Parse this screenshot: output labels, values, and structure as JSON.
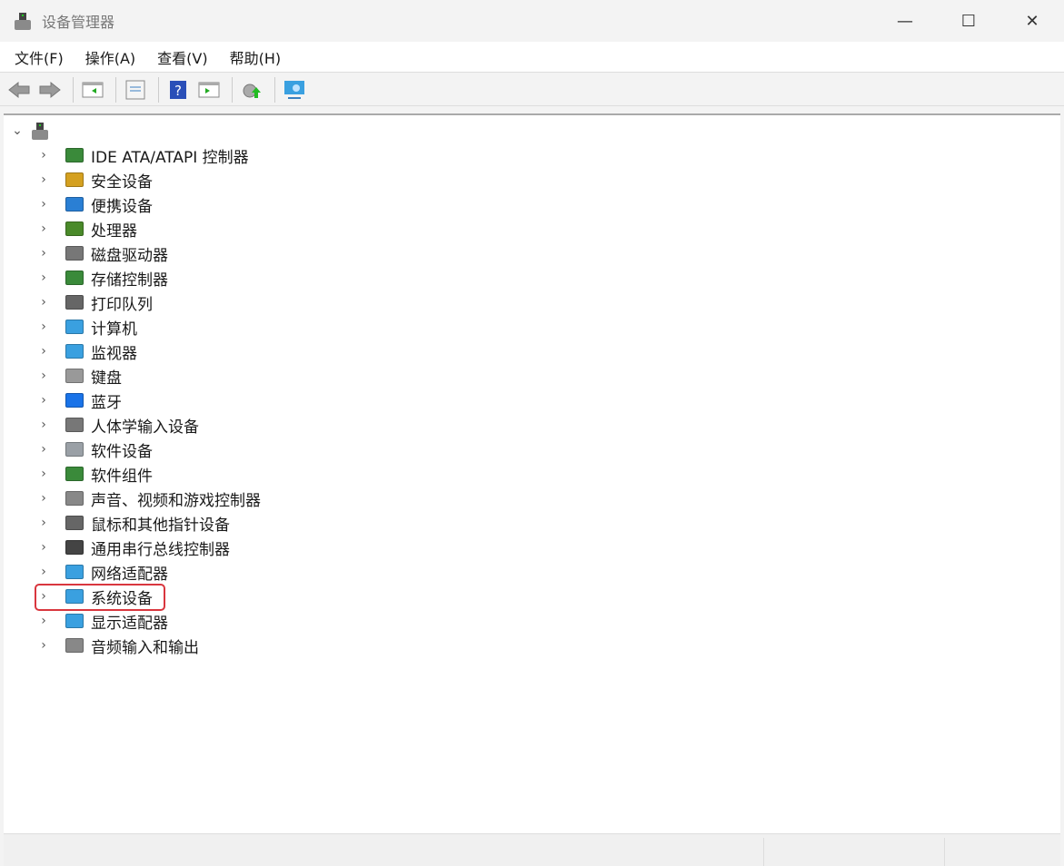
{
  "window": {
    "title": "设备管理器",
    "minimize": "—",
    "maximize": "☐",
    "close": "✕"
  },
  "menu": [
    "文件(F)",
    "操作(A)",
    "查看(V)",
    "帮助(H)"
  ],
  "toolbar": [
    "back",
    "forward",
    "show-hide-console-tree",
    "properties",
    "help",
    "show-action-pane",
    "update-driver",
    "scan-hardware-changes"
  ],
  "tree": {
    "root_label": "",
    "items": [
      {
        "label": "IDE ATA/ATAPI 控制器",
        "icon": "ide-controller-icon",
        "color": "#3a8a3a"
      },
      {
        "label": "安全设备",
        "icon": "security-device-icon",
        "color": "#d4a020"
      },
      {
        "label": "便携设备",
        "icon": "portable-device-icon",
        "color": "#2a7fd4"
      },
      {
        "label": "处理器",
        "icon": "processor-icon",
        "color": "#4a8a2a"
      },
      {
        "label": "磁盘驱动器",
        "icon": "disk-drive-icon",
        "color": "#777777"
      },
      {
        "label": "存储控制器",
        "icon": "storage-controller-icon",
        "color": "#3a8a3a"
      },
      {
        "label": "打印队列",
        "icon": "printer-icon",
        "color": "#666666"
      },
      {
        "label": "计算机",
        "icon": "computer-icon",
        "color": "#3aa0e0"
      },
      {
        "label": "监视器",
        "icon": "monitor-icon",
        "color": "#3aa0e0"
      },
      {
        "label": "键盘",
        "icon": "keyboard-icon",
        "color": "#999999"
      },
      {
        "label": "蓝牙",
        "icon": "bluetooth-icon",
        "color": "#1a73e8"
      },
      {
        "label": "人体学输入设备",
        "icon": "hid-icon",
        "color": "#777777"
      },
      {
        "label": "软件设备",
        "icon": "software-device-icon",
        "color": "#9aa0a6"
      },
      {
        "label": "软件组件",
        "icon": "software-component-icon",
        "color": "#3a8a3a"
      },
      {
        "label": "声音、视频和游戏控制器",
        "icon": "speaker-icon",
        "color": "#888888"
      },
      {
        "label": "鼠标和其他指针设备",
        "icon": "mouse-icon",
        "color": "#666666"
      },
      {
        "label": "通用串行总线控制器",
        "icon": "usb-icon",
        "color": "#444444"
      },
      {
        "label": "网络适配器",
        "icon": "network-adapter-icon",
        "color": "#3aa0e0"
      },
      {
        "label": "系统设备",
        "icon": "system-device-icon",
        "color": "#3aa0e0"
      },
      {
        "label": "显示适配器",
        "icon": "display-adapter-icon",
        "color": "#3aa0e0"
      },
      {
        "label": "音频输入和输出",
        "icon": "audio-icon",
        "color": "#888888"
      }
    ]
  }
}
